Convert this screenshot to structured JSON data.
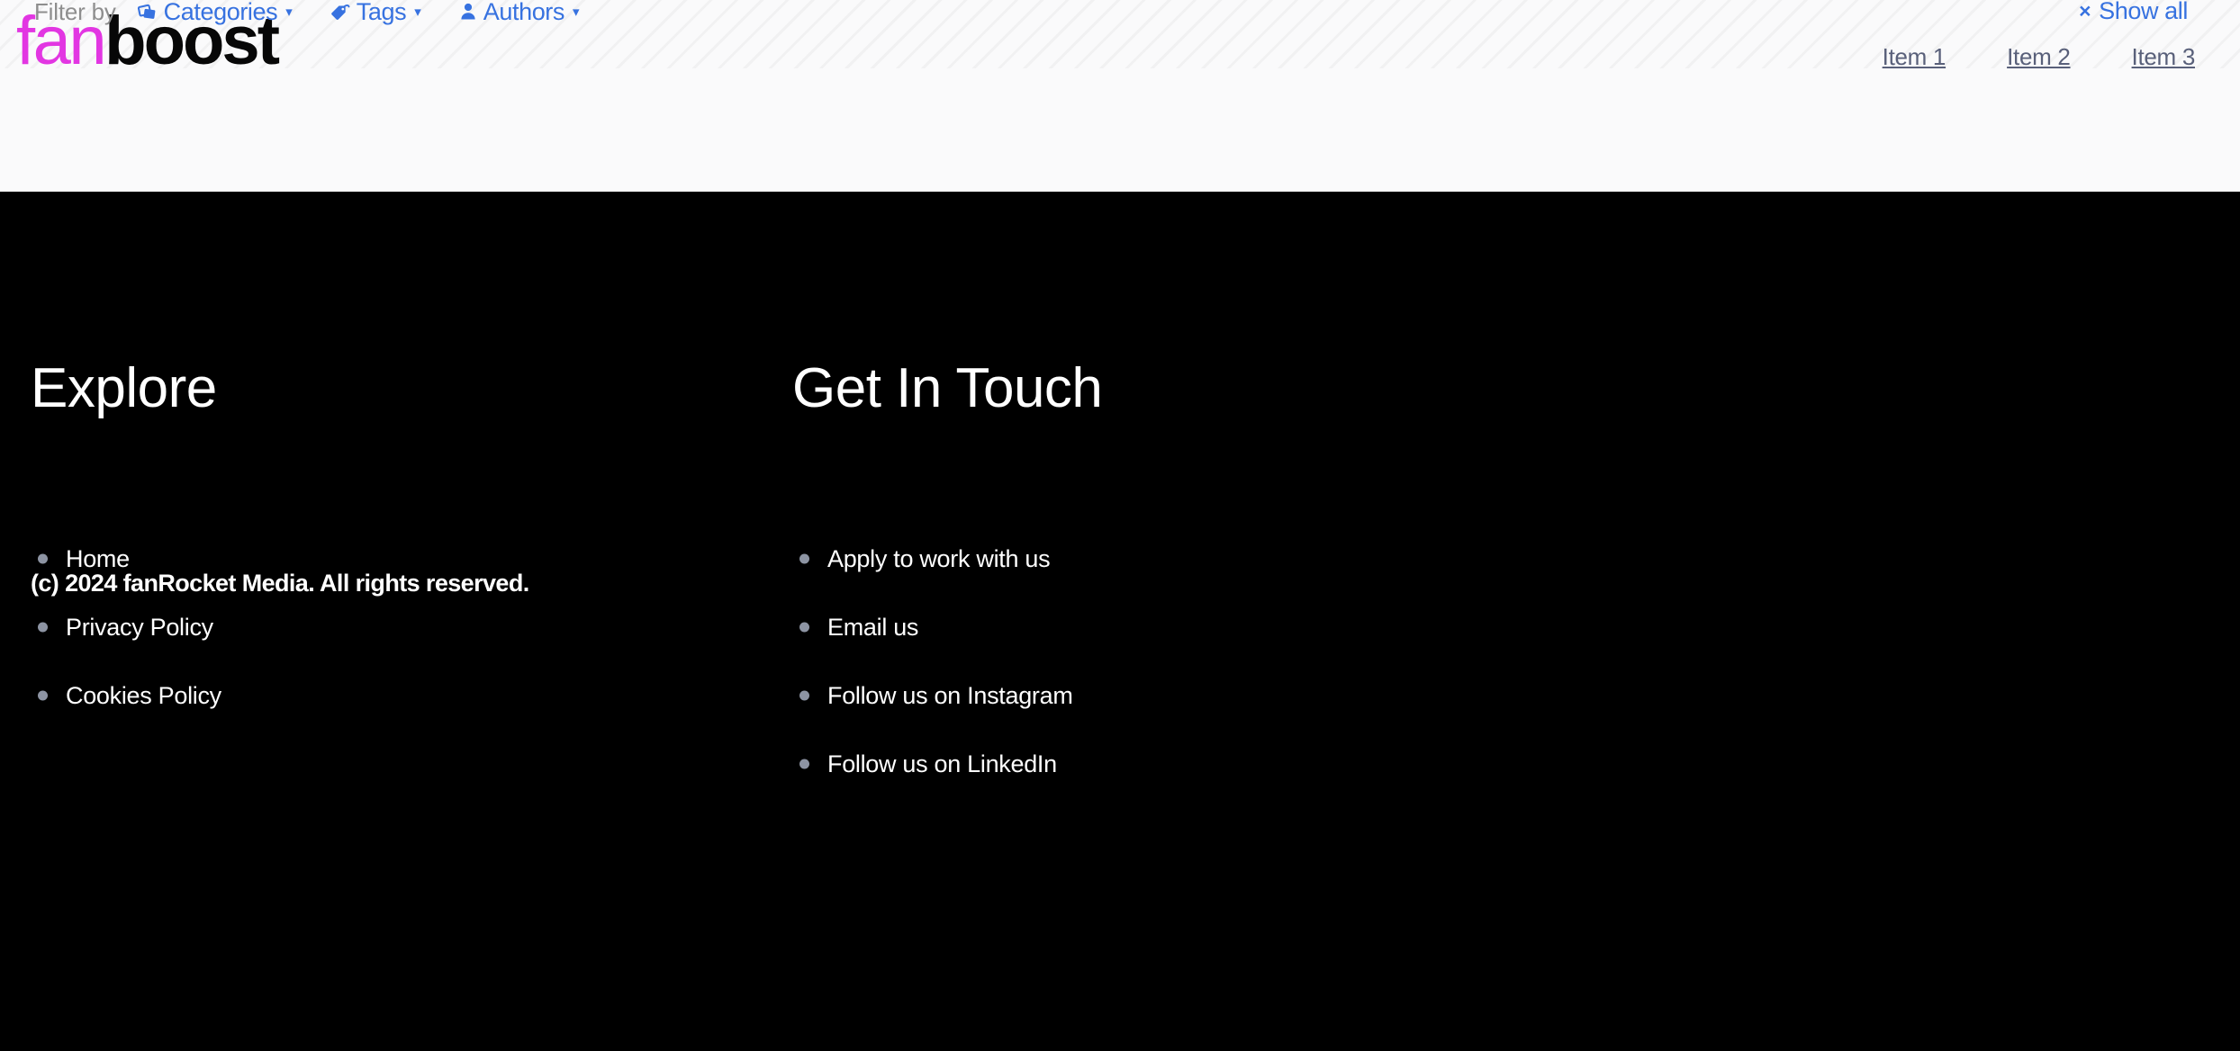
{
  "header": {
    "filter": {
      "label": "Filter by",
      "groups": [
        {
          "label": "Categories",
          "icon": "categories-stack-icon",
          "caret": "▾"
        },
        {
          "label": "Tags",
          "icon": "tag-icon",
          "caret": "▾"
        },
        {
          "label": "Authors",
          "icon": "person-icon",
          "caret": "▾"
        }
      ],
      "show_all": {
        "x": "×",
        "label": "Show all"
      }
    },
    "logo": {
      "part1": "fan",
      "part2": "boost"
    },
    "nav_items": [
      {
        "label": "Item 1"
      },
      {
        "label": "Item 2"
      },
      {
        "label": "Item 3"
      }
    ]
  },
  "footer": {
    "columns": [
      {
        "title": "Explore",
        "links": [
          {
            "label": "Home"
          },
          {
            "label": "Privacy Policy"
          },
          {
            "label": "Cookies Policy"
          }
        ]
      },
      {
        "title": "Get In Touch",
        "links": [
          {
            "label": "Apply to work with us"
          },
          {
            "label": "Email us"
          },
          {
            "label": "Follow us on Instagram"
          },
          {
            "label": "Follow us on LinkedIn"
          }
        ]
      }
    ],
    "copyright": "(c) 2024 fanRocket Media. All rights reserved."
  },
  "colors": {
    "brand_magenta": "#e236e2",
    "brand_black": "#070707",
    "link_blue": "#3772e0",
    "nav_slate": "#59607a",
    "filter_gray": "#8e8e8e",
    "bullet_gray": "#8d94a3",
    "footer_bg": "#000000",
    "header_bg": "#fafafb"
  }
}
